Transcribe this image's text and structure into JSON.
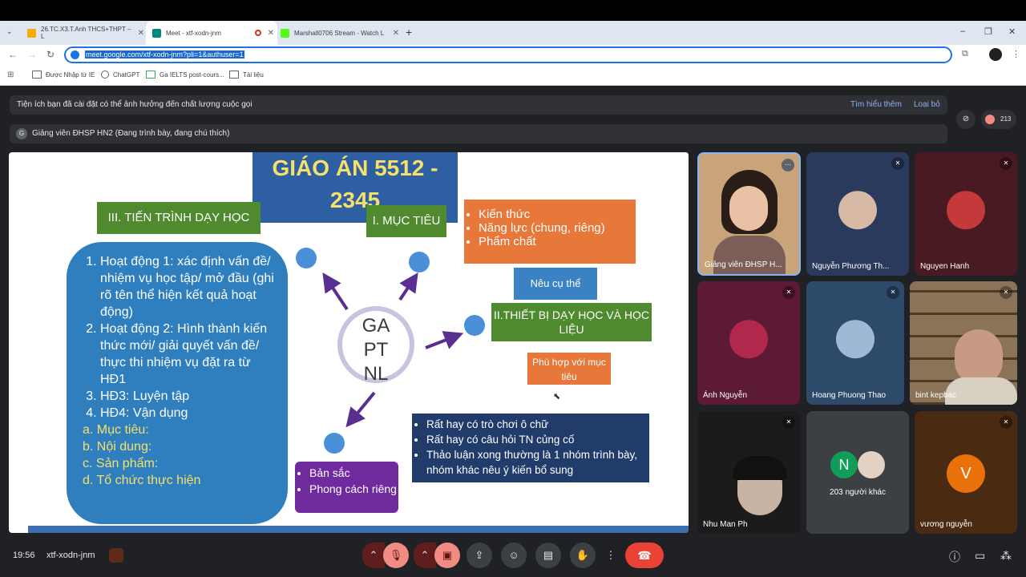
{
  "browser": {
    "tabs": [
      {
        "label": "26.TC.X3.T.Anh THCS+THPT – L",
        "favicon_color": "#f9ab00"
      },
      {
        "label": "Meet - xtf-xodn-jnm",
        "favicon_color": "#00897b"
      },
      {
        "label": "Marshall0706 Stream - Watch L",
        "favicon_color": "#53fc18"
      }
    ],
    "new_tab": "+",
    "url": "meet.google.com/xtf-xodn-jnm?pli=1&authuser=1",
    "bookmarks": [
      "Được Nhập từ IE",
      "ChatGPT",
      "Ga IELTS post-cours...",
      "Tài liệu"
    ],
    "window_controls": [
      "–",
      "❐",
      "✕"
    ]
  },
  "meet": {
    "banner_text": "Tiện ích bạn đã cài đặt có thể ảnh hưởng đến chất lượng cuộc gọi",
    "banner_learn_more": "Tìm hiểu thêm",
    "banner_dismiss": "Loại bỏ",
    "participant_count": "213",
    "presenter_initial": "G",
    "presenter_label": "Giảng viên ĐHSP HN2 (Đang trình bày, đang chú thích)",
    "meeting_time": "19:56",
    "meeting_code": "xtf-xodn-jnm"
  },
  "slide": {
    "title": "GIÁO ÁN 5512 - 2345",
    "section3": "III. TIẾN TRÌNH DẠY HỌC",
    "section1": "I. MỤC TIÊU",
    "objectives": [
      "Kiến thức",
      "Năng lực (chung, riêng)",
      "Phẩm chất"
    ],
    "specific": "Nêu cụ thể",
    "section2": "II.THIẾT BỊ DẠY HỌC VÀ HỌC LIỆU",
    "fit": "Phù hợp với mục tiêu",
    "center": [
      "GA",
      "PT",
      "NL"
    ],
    "activities": [
      "Hoạt động 1: xác định vấn đề/ nhiệm vụ học tập/ mở đầu (ghi rõ tên thể hiện kết quả hoạt động)",
      "Hoạt động 2: Hình thành kiến thức mới/ giải quyết vấn đề/ thực thi nhiệm vụ đặt ra từ HĐ1",
      "HĐ3: Luyện tập",
      "HĐ4: Vận dụng"
    ],
    "sub_items": [
      "a.  Mục tiêu:",
      "b.  Nội dung:",
      "c.  Sản phẩm:",
      "d.  Tổ chức thực hiện"
    ],
    "notes": [
      "Rất hay có trò chơi ô chữ",
      "Rất hay có câu hỏi TN củng cố",
      "Thảo luận xong thường là 1 nhóm trình bày, nhóm khác nêu ý kiến bổ sung"
    ],
    "style": [
      "Bản sắc",
      "Phong cách riêng"
    ]
  },
  "participants": [
    {
      "name": "Giảng viên ĐHSP H...",
      "bg": "#c9a47a"
    },
    {
      "name": "Nguyễn Phương Th...",
      "bg": "#2a3a5c"
    },
    {
      "name": "Nguyen Hanh",
      "bg": "#4a1a22"
    },
    {
      "name": "Ánh Nguyễn",
      "bg": "#5c1a34"
    },
    {
      "name": "Hoang Phuong Thao",
      "bg": "#2d4a6b"
    },
    {
      "name": "bint kepbac",
      "bg": "#6b5a44"
    },
    {
      "name": "Nhu Man Ph",
      "bg": "#1b1b1b"
    },
    {
      "name": "203 người khác",
      "bg": "#3c4043"
    },
    {
      "name": "vương nguyễn",
      "bg": "#4a2a10"
    }
  ],
  "others_initial": "N",
  "vuong_initial": "V",
  "controls": {
    "mic_icon": "mic-off-icon",
    "cam_icon": "camera-off-icon",
    "present_icon": "present-icon",
    "emoji_icon": "emoji-icon",
    "captions_icon": "captions-icon",
    "hand_icon": "raise-hand-icon",
    "more_icon": "more-vert-icon",
    "end_icon": "end-call-icon"
  },
  "colors": {
    "accent": "#1a73e8",
    "end_call": "#ea4335",
    "muted": "#f28b82"
  }
}
